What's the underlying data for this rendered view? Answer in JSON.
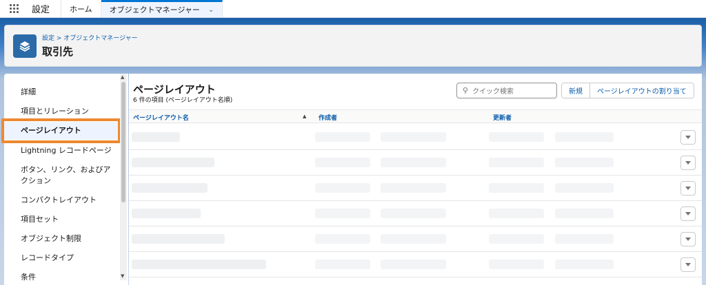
{
  "topnav": {
    "app_name": "設定",
    "tabs": [
      {
        "label": "ホーム"
      },
      {
        "label": "オブジェクトマネージャー"
      }
    ]
  },
  "header": {
    "breadcrumb": "設定 > オブジェクトマネージャー",
    "title": "取引先",
    "icon": "layers-icon"
  },
  "sidebar": {
    "items": [
      {
        "label": "詳細"
      },
      {
        "label": "項目とリレーション"
      },
      {
        "label": "ページレイアウト"
      },
      {
        "label": "Lightning レコードページ"
      },
      {
        "label": "ボタン、リンク、およびア"
      },
      {
        "label": "クション"
      },
      {
        "label": "コンパクトレイアウト"
      },
      {
        "label": "項目セット"
      },
      {
        "label": "オブジェクト制限"
      },
      {
        "label": "レコードタイプ"
      },
      {
        "label": "条件"
      }
    ],
    "selected": "ページレイアウト"
  },
  "main": {
    "title": "ページレイアウト",
    "subtitle": "6 件の項目 (ページレイアウト名順)",
    "search_placeholder": "クイック検索",
    "buttons": {
      "new": "新規",
      "assign": "ページレイアウトの割り当て"
    },
    "columns": [
      "ページレイアウト名",
      "作成者",
      "更新者"
    ],
    "row_count": 6
  },
  "colors": {
    "accent": "#0176d3",
    "link": "#0b5cab",
    "highlight": "#ed8a31",
    "object_icon": "#2a6aa8"
  }
}
